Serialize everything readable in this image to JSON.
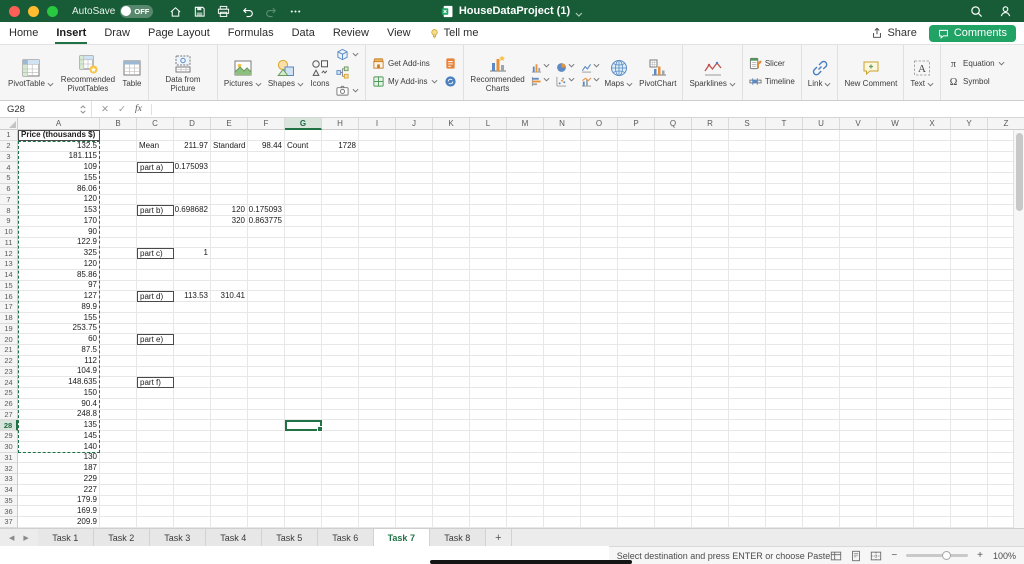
{
  "colors": {
    "titlebar_green": "#185c37",
    "accent_green": "#217346",
    "comments_button_green": "#21a366",
    "selection_green": "#217346"
  },
  "titlebar": {
    "autosave_label": "AutoSave",
    "autosave_state": "OFF",
    "quick_icons": [
      "home-icon",
      "save-icon",
      "print-icon",
      "undo-icon",
      "redo-icon",
      "more-icon"
    ],
    "doc_icon": "excel-doc-icon",
    "title": "HouseDataProject (1)",
    "right_icons": [
      "search-icon",
      "person-icon"
    ]
  },
  "menubar": {
    "tabs": [
      {
        "label": "Home",
        "active": false
      },
      {
        "label": "Insert",
        "active": true
      },
      {
        "label": "Draw",
        "active": false
      },
      {
        "label": "Page Layout",
        "active": false
      },
      {
        "label": "Formulas",
        "active": false
      },
      {
        "label": "Data",
        "active": false
      },
      {
        "label": "Review",
        "active": false
      },
      {
        "label": "View",
        "active": false
      },
      {
        "label": "Tell me",
        "active": false,
        "icon": "bulb-icon"
      }
    ],
    "share_label": "Share",
    "comments_label": "Comments"
  },
  "ribbon": {
    "groups": [
      {
        "name": "tables",
        "items": [
          {
            "type": "large",
            "label": "PivotTable",
            "icon": "pivottable-icon",
            "chevron": true
          },
          {
            "type": "large",
            "label": "Recommended PivotTables",
            "icon": "recommended-pivottables-icon",
            "chevron": false
          },
          {
            "type": "large",
            "label": "Table",
            "icon": "table-icon",
            "chevron": false
          }
        ]
      },
      {
        "name": "picture-data",
        "items": [
          {
            "type": "large",
            "label": "Data from Picture",
            "icon": "data-from-picture-icon",
            "chevron": false
          }
        ]
      },
      {
        "name": "illustrations",
        "items": [
          {
            "type": "large",
            "label": "Pictures",
            "icon": "pictures-icon",
            "chevron": true
          },
          {
            "type": "large",
            "label": "Shapes",
            "icon": "shapes-icon",
            "chevron": true
          },
          {
            "type": "large",
            "label": "Icons",
            "icon": "icons-icon",
            "chevron": false
          },
          {
            "type": "stack",
            "items": [
              {
                "type": "smallicon",
                "icon": "3d-models-icon",
                "chevron": true
              },
              {
                "type": "smallicon",
                "icon": "smartart-icon",
                "chevron": false
              },
              {
                "type": "smallicon",
                "icon": "screenshot-icon",
                "chevron": true
              }
            ]
          }
        ]
      },
      {
        "name": "add-ins",
        "items": [
          {
            "type": "stack",
            "items": [
              {
                "type": "smallwide",
                "label": "Get Add-ins",
                "icon": "get-addins-icon",
                "chevron": false
              },
              {
                "type": "smallwide",
                "label": "My Add-ins",
                "icon": "my-addins-icon",
                "chevron": true
              }
            ]
          },
          {
            "type": "stack",
            "items": [
              {
                "type": "smallicon",
                "icon": "recent-addin-icon",
                "chevron": false
              },
              {
                "type": "smallicon",
                "icon": "refresh-addin-icon",
                "chevron": false
              }
            ]
          }
        ]
      },
      {
        "name": "charts",
        "items": [
          {
            "type": "large",
            "label": "Recommended Charts",
            "icon": "recommended-charts-icon",
            "chevron": false
          },
          {
            "type": "chartgrid",
            "rows": [
              [
                {
                  "icon": "column-chart-icon"
                },
                {
                  "icon": "pie-chart-icon"
                },
                {
                  "icon": "line-chart-icon"
                }
              ],
              [
                {
                  "icon": "bar-chart-icon"
                },
                {
                  "icon": "scatter-chart-icon"
                },
                {
                  "icon": "combo-chart-icon"
                }
              ]
            ]
          },
          {
            "type": "large",
            "label": "Maps",
            "icon": "maps-icon",
            "chevron": true
          },
          {
            "type": "large",
            "label": "PivotChart",
            "icon": "pivotchart-icon",
            "chevron": false
          }
        ]
      },
      {
        "name": "sparklines",
        "items": [
          {
            "type": "large",
            "label": "Sparklines",
            "icon": "sparklines-icon",
            "chevron": true
          }
        ]
      },
      {
        "name": "filters",
        "items": [
          {
            "type": "stack",
            "items": [
              {
                "type": "smallwide",
                "label": "Slicer",
                "icon": "slicer-icon",
                "chevron": false
              },
              {
                "type": "smallwide",
                "label": "Timeline",
                "icon": "timeline-icon",
                "chevron": false
              }
            ]
          }
        ]
      },
      {
        "name": "links",
        "items": [
          {
            "type": "large",
            "label": "Link",
            "icon": "link-icon",
            "chevron": true
          }
        ]
      },
      {
        "name": "comments",
        "items": [
          {
            "type": "large",
            "label": "New Comment",
            "icon": "new-comment-icon",
            "chevron": false
          }
        ]
      },
      {
        "name": "text",
        "items": [
          {
            "type": "large",
            "label": "Text",
            "icon": "text-icon",
            "chevron": true
          }
        ]
      },
      {
        "name": "symbols",
        "items": [
          {
            "type": "stack",
            "items": [
              {
                "type": "smallwide",
                "label": "Equation",
                "icon": "equation-icon",
                "chevron": true
              },
              {
                "type": "smallwide",
                "label": "Symbol",
                "icon": "symbol-icon",
                "chevron": false
              }
            ]
          }
        ]
      }
    ]
  },
  "formula_bar": {
    "name_box": "G28",
    "cancel_glyph": "✕",
    "enter_glyph": "✓",
    "fx_label": "fx",
    "formula_value": ""
  },
  "grid": {
    "columns": [
      "A",
      "B",
      "C",
      "D",
      "E",
      "F",
      "G",
      "H",
      "I",
      "J",
      "K",
      "L",
      "M",
      "N",
      "O",
      "P",
      "Q",
      "R",
      "S",
      "T",
      "U",
      "V",
      "W",
      "X",
      "Y",
      "Z"
    ],
    "row_count": 37,
    "selected_cell": {
      "ref": "G28",
      "col": "G",
      "row": 28
    },
    "copy_range": {
      "range": "A2:A30",
      "col": "A",
      "row_start": 2,
      "row_end": 30
    },
    "cells": {
      "A1": {
        "v": "Price (thousands $)",
        "bold": true,
        "align": "left",
        "box": true
      },
      "A2": {
        "v": "132.5"
      },
      "A3": {
        "v": "181.115"
      },
      "A4": {
        "v": "109"
      },
      "A5": {
        "v": "155"
      },
      "A6": {
        "v": "86.06"
      },
      "A7": {
        "v": "120"
      },
      "A8": {
        "v": "153"
      },
      "A9": {
        "v": "170"
      },
      "A10": {
        "v": "90"
      },
      "A11": {
        "v": "122.9"
      },
      "A12": {
        "v": "325"
      },
      "A13": {
        "v": "120"
      },
      "A14": {
        "v": "85.86"
      },
      "A15": {
        "v": "97"
      },
      "A16": {
        "v": "127"
      },
      "A17": {
        "v": "89.9"
      },
      "A18": {
        "v": "155"
      },
      "A19": {
        "v": "253.75"
      },
      "A20": {
        "v": "60"
      },
      "A21": {
        "v": "87.5"
      },
      "A22": {
        "v": "112"
      },
      "A23": {
        "v": "104.9"
      },
      "A24": {
        "v": "148.635"
      },
      "A25": {
        "v": "150"
      },
      "A26": {
        "v": "90.4"
      },
      "A27": {
        "v": "248.8"
      },
      "A28": {
        "v": "135"
      },
      "A29": {
        "v": "145"
      },
      "A30": {
        "v": "140"
      },
      "A31": {
        "v": "130"
      },
      "A32": {
        "v": "187"
      },
      "A33": {
        "v": "229"
      },
      "A34": {
        "v": "227"
      },
      "A35": {
        "v": "179.9"
      },
      "A36": {
        "v": "169.9"
      },
      "A37": {
        "v": "209.9"
      },
      "C2": {
        "v": "Mean",
        "align": "left"
      },
      "D2": {
        "v": "211.97"
      },
      "E2": {
        "v": "Standard D",
        "align": "left"
      },
      "F2": {
        "v": "98.44"
      },
      "G2": {
        "v": "Count",
        "align": "left"
      },
      "H2": {
        "v": "1728"
      },
      "C4": {
        "v": "part a)",
        "align": "left",
        "box": true
      },
      "D4": {
        "v": "0.175093"
      },
      "C8": {
        "v": "part b)",
        "align": "left",
        "box": true
      },
      "D8": {
        "v": "0.698682"
      },
      "E8": {
        "v": "120"
      },
      "F8": {
        "v": "0.175093"
      },
      "E9": {
        "v": "320"
      },
      "F9": {
        "v": "0.863775"
      },
      "C12": {
        "v": "part c)",
        "align": "left",
        "box": true
      },
      "D12": {
        "v": "1"
      },
      "C16": {
        "v": "part d)",
        "align": "left",
        "box": true
      },
      "D16": {
        "v": "113.53"
      },
      "E16": {
        "v": "310.41"
      },
      "C20": {
        "v": "part e)",
        "align": "left",
        "box": true
      },
      "C24": {
        "v": "part f)",
        "align": "left",
        "box": true
      }
    }
  },
  "sheet_tabs": {
    "nav_icons": [
      "tab-scroll-left-icon",
      "tab-scroll-right-icon"
    ],
    "tabs": [
      {
        "label": "Task 1",
        "active": false
      },
      {
        "label": "Task 2",
        "active": false
      },
      {
        "label": "Task 3",
        "active": false
      },
      {
        "label": "Task 4",
        "active": false
      },
      {
        "label": "Task 5",
        "active": false
      },
      {
        "label": "Task 6",
        "active": false
      },
      {
        "label": "Task 7",
        "active": true
      },
      {
        "label": "Task 8",
        "active": false
      }
    ],
    "add_label": "+"
  },
  "status_bar": {
    "message": "Select destination and press ENTER or choose Paste",
    "view_icons": [
      "normal-view-icon",
      "page-layout-view-icon",
      "page-break-preview-icon"
    ],
    "zoom_minus": "−",
    "zoom_plus": "+",
    "zoom_label": "100%"
  }
}
